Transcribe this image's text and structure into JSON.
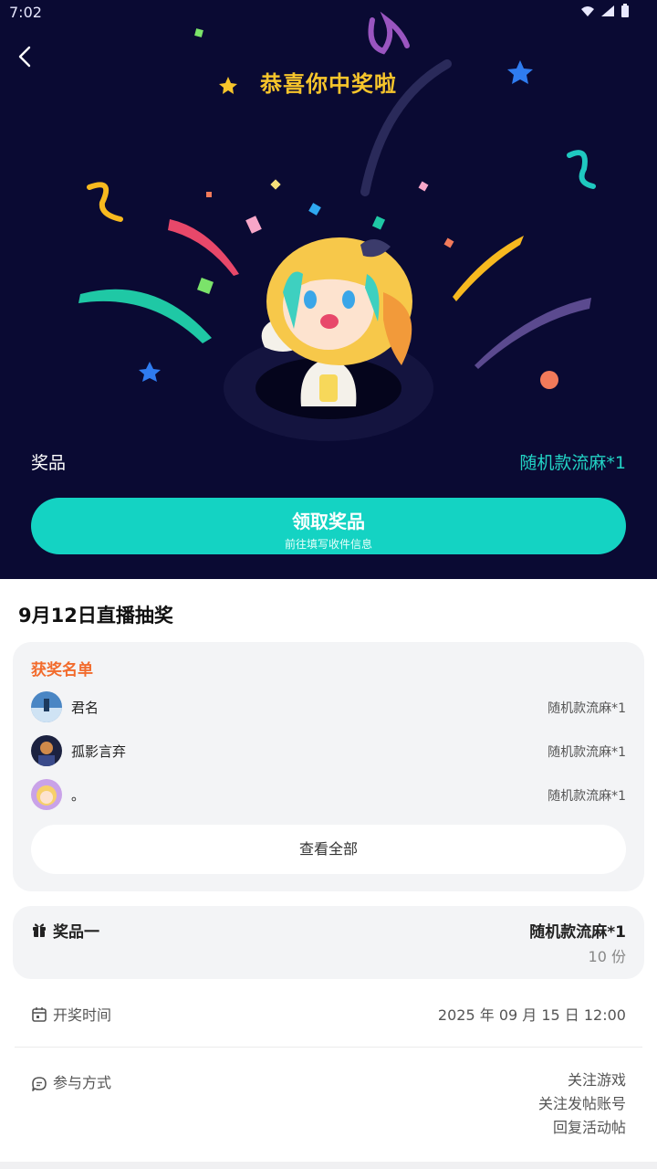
{
  "status_bar": {
    "time": "7:02"
  },
  "hero": {
    "title": "恭喜你中奖啦",
    "prize_label": "奖品",
    "prize_value": "随机款流麻*1",
    "claim_button": {
      "title": "领取奖品",
      "subtitle": "前往填写收件信息"
    },
    "colors": {
      "background": "#0a0a33",
      "title": "#f7c52b",
      "accent": "#14d3c3"
    }
  },
  "lottery": {
    "title": "9月12日直播抽奖",
    "winners_heading": "获奖名单",
    "winners": [
      {
        "name": "君名",
        "prize": "随机款流麻*1"
      },
      {
        "name": "孤影言弃",
        "prize": "随机款流麻*1"
      },
      {
        "name": "。",
        "prize": "随机款流麻*1"
      }
    ],
    "view_all_label": "查看全部"
  },
  "prize_card": {
    "label": "奖品一",
    "name": "随机款流麻*1",
    "quantity": "10 份"
  },
  "draw_time": {
    "label": "开奖时间",
    "value": "2025 年 09 月 15 日 12:00"
  },
  "participation": {
    "label": "参与方式",
    "methods": [
      "关注游戏",
      "关注发帖账号",
      "回复活动帖"
    ]
  }
}
